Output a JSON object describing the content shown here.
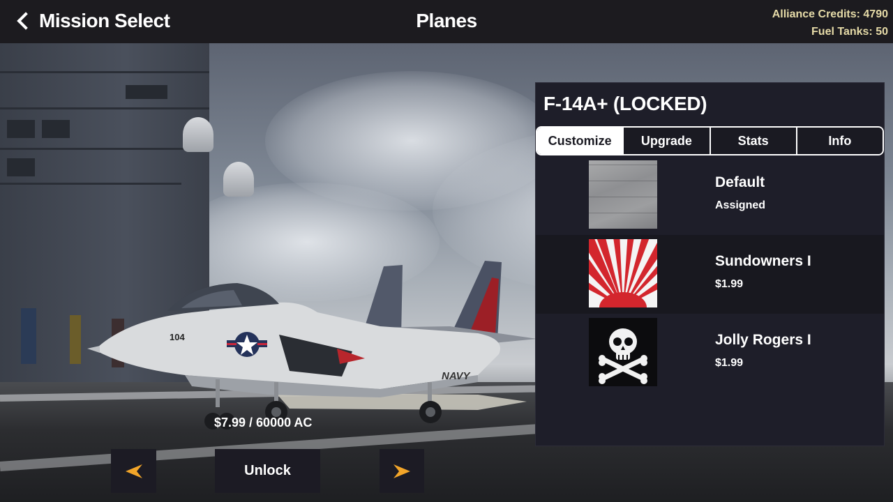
{
  "header": {
    "back_label": "Mission Select",
    "title": "Planes",
    "credits_text": "Alliance Credits: 4790",
    "fuel_text": "Fuel Tanks: 50"
  },
  "plane": {
    "name": "F-14A+ (LOCKED)",
    "price": "$7.99 / 60000 AC"
  },
  "tabs": [
    {
      "label": "Customize",
      "active": true
    },
    {
      "label": "Upgrade",
      "active": false
    },
    {
      "label": "Stats",
      "active": false
    },
    {
      "label": "Info",
      "active": false
    }
  ],
  "skins": [
    {
      "name": "Default",
      "status": "Assigned",
      "thumb": "bare-metal-texture"
    },
    {
      "name": "Sundowners I",
      "status": "$1.99",
      "thumb": "rising-sun-pattern"
    },
    {
      "name": "Jolly Rogers I",
      "status": "$1.99",
      "thumb": "skull-crossbones-emblem"
    }
  ],
  "controls": {
    "unlock_label": "Unlock",
    "prev_icon": "arrow-left-icon",
    "next_icon": "arrow-right-icon"
  },
  "colors": {
    "topbar_bg": "#1c1b1f",
    "panel_bg": "#1e1e29",
    "currency_text": "#e6dba8",
    "arrow_accent": "#f2a529",
    "sun_red": "#d3262d"
  },
  "scene": {
    "jet_tail_number": "104",
    "jet_markings": "NAVY"
  }
}
